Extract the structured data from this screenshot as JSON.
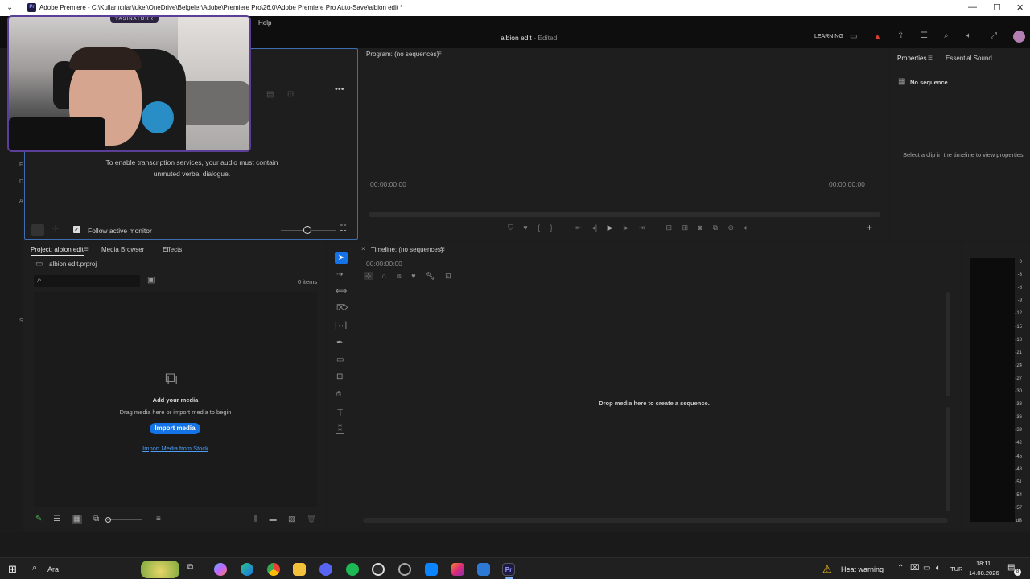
{
  "window": {
    "title": "Adobe Premiere - C:\\Kullanıcılar\\jukel\\OneDrive\\Belgeler\\Adobe\\Premiere Pro\\26.0\\Adobe Premiere Pro Auto-Save\\albion edit *",
    "logo": "Pr"
  },
  "menubar": {
    "help": "Help"
  },
  "appbar": {
    "project_title": "albion edit",
    "status": "- Edited",
    "learning": "LEARNING"
  },
  "webcam": {
    "brand": "YASINATORR"
  },
  "source_panel": {
    "message_line1": "To enable transcription services, your audio must contain",
    "message_line2": "unmuted verbal dialogue.",
    "follow_label": "Follow active monitor",
    "follow_checked": true
  },
  "program_monitor": {
    "tab_label": "Program: (no sequences)",
    "timecode_left": "00:00:00:00",
    "timecode_right": "00:00:00:00"
  },
  "properties_panel": {
    "tabs": [
      "Properties",
      "Essential Sound"
    ],
    "no_sequence": "No sequence",
    "hint": "Select a clip in the timeline to view properties."
  },
  "project_panel": {
    "tabs": [
      "Project: albion edit",
      "Media Browser",
      "Effects"
    ],
    "file_name": "albion edit.prproj",
    "search_placeholder": "",
    "items_count": "0 items",
    "empty_title": "Add your media",
    "empty_sub": "Drag media here or import media to begin",
    "import_button": "Import media",
    "import_stock_link": "Import Media from Stock"
  },
  "timeline": {
    "tab_label": "Timeline: (no sequences)",
    "timecode": "00:00:00:00",
    "drop_message": "Drop media here to create a sequence."
  },
  "audio_meter": {
    "ticks": [
      "0",
      "-3",
      "-6",
      "-9",
      "-12",
      "-15",
      "-18",
      "-21",
      "-24",
      "-27",
      "-30",
      "-33",
      "-36",
      "-39",
      "-42",
      "-45",
      "-48",
      "-51",
      "-54",
      "-57",
      "dB"
    ]
  },
  "taskbar": {
    "search_label": "Ara",
    "heat_warning": "Heat warning",
    "language": "TUR",
    "time": "18:11",
    "date": "14.08.2026",
    "notification_count": "8"
  },
  "colors": {
    "accent": "#1473e6",
    "panel_bg": "#1e1e1e",
    "focus_border": "#3d6db5",
    "alert_red": "#e03c31",
    "webcam_frame": "#5b3f96"
  }
}
